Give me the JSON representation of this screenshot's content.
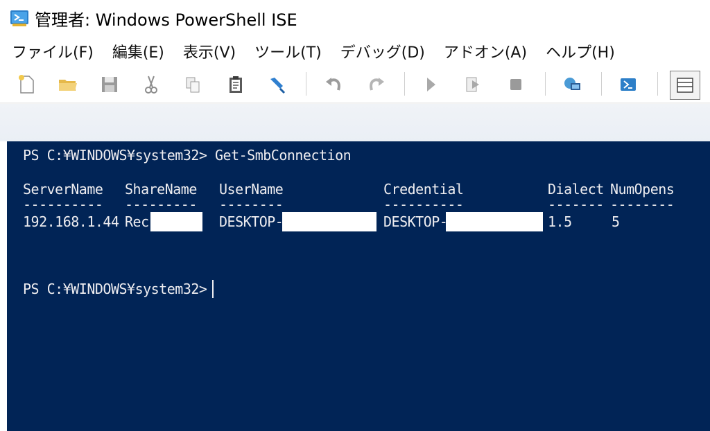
{
  "window": {
    "title": "管理者: Windows PowerShell ISE",
    "icon": "powershell-ise-icon"
  },
  "menu": {
    "items": [
      {
        "label": "ファイル(F)"
      },
      {
        "label": "編集(E)"
      },
      {
        "label": "表示(V)"
      },
      {
        "label": "ツール(T)"
      },
      {
        "label": "デバッグ(D)"
      },
      {
        "label": "アドオン(A)"
      },
      {
        "label": "ヘルプ(H)"
      }
    ]
  },
  "toolbar": {
    "icons": [
      "new-file-icon",
      "open-folder-icon",
      "save-icon",
      "cut-icon",
      "copy-icon",
      "paste-icon",
      "clear-console-icon",
      "undo-icon",
      "redo-icon",
      "run-icon",
      "run-selection-icon",
      "stop-icon",
      "remote-powershell-icon",
      "powershell-icon",
      "show-script-pane-icon"
    ]
  },
  "console": {
    "prompt1": "PS C:¥WINDOWS¥system32> Get-SmbConnection",
    "headers": {
      "server": "ServerName",
      "share": "ShareName",
      "user": "UserName",
      "credential": "Credential",
      "dialect": "Dialect",
      "numopens": "NumOpens"
    },
    "dashes": {
      "server": "----------",
      "share": "---------",
      "user": "--------",
      "credential": "----------",
      "dialect": "-------",
      "numopens": "--------"
    },
    "row": {
      "server": "192.168.1.44",
      "share": "Rec",
      "user": "DESKTOP-",
      "credential": "DESKTOP-",
      "dialect": "1.5",
      "numopens": "5"
    },
    "prompt2": "PS C:¥WINDOWS¥system32> ",
    "colors": {
      "background": "#012456",
      "text": "#eeedf0"
    }
  }
}
